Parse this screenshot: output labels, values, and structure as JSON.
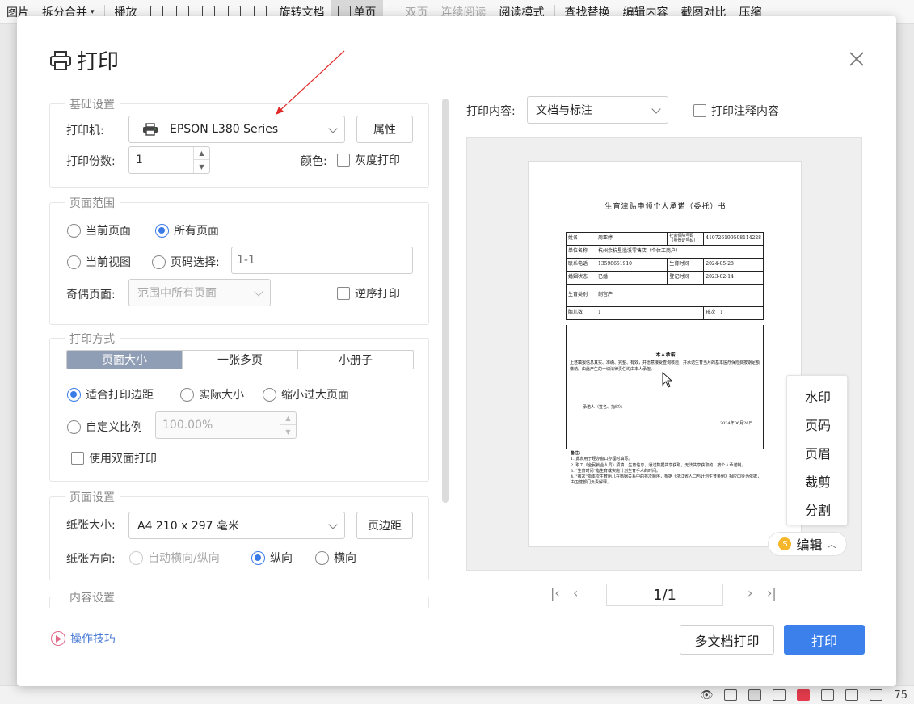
{
  "app_toolbar": {
    "items": [
      "图片",
      "拆分合并",
      "播放",
      "旋转文档",
      "单页",
      "双页",
      "连续阅读",
      "阅读模式",
      "查找替换",
      "编辑内容",
      "截图对比",
      "压缩"
    ]
  },
  "statusbar": {
    "zoom": "75"
  },
  "dialog": {
    "title": "打印",
    "basic": {
      "legend": "基础设置",
      "printer_label": "打印机:",
      "printer_value": "EPSON L380 Series",
      "properties_btn": "属性",
      "copies_label": "打印份数:",
      "copies_value": "1",
      "color_label": "颜色:",
      "grayscale_label": "灰度打印"
    },
    "range": {
      "legend": "页面范围",
      "current_page": "当前页面",
      "all_pages": "所有页面",
      "current_view": "当前视图",
      "page_select": "页码选择:",
      "page_select_placeholder": "1-1",
      "odd_even_label": "奇偶页面:",
      "odd_even_value": "范围中所有页面",
      "reverse_label": "逆序打印"
    },
    "mode": {
      "legend": "打印方式",
      "tabs": [
        "页面大小",
        "一张多页",
        "小册子"
      ],
      "fit_margin": "适合打印边距",
      "actual_size": "实际大小",
      "shrink_large": "缩小过大页面",
      "custom_scale": "自定义比例",
      "custom_scale_value": "100.00%",
      "duplex_label": "使用双面打印"
    },
    "page_setup": {
      "legend": "页面设置",
      "paper_size_label": "纸张大小:",
      "paper_size_value": "A4 210 x 297 毫米",
      "margin_btn": "页边距",
      "orientation_label": "纸张方向:",
      "auto": "自动横向/纵向",
      "portrait": "纵向",
      "landscape": "横向"
    },
    "content_setup": {
      "legend": "内容设置"
    },
    "preview": {
      "content_label": "打印内容:",
      "content_value": "文档与标注",
      "print_annotations": "打印注释内容",
      "side_menu": [
        "水印",
        "页码",
        "页眉",
        "裁剪",
        "分割"
      ],
      "edit_btn": "编辑",
      "page_indicator": "1/1"
    },
    "footer": {
      "tips": "操作技巧",
      "multi_doc_print": "多文档打印",
      "print": "打印"
    }
  },
  "document": {
    "title": "生育津贴申领个人承诺（委托）书",
    "rows": [
      [
        "姓名",
        "周亚婷",
        "社会保障号码（身份证号码）",
        "410726199508114228"
      ],
      [
        "单位名称",
        "杭州余杭星溢溪零售店（个体工商户）",
        "",
        ""
      ],
      [
        "联系电话",
        "13598651910",
        "生育时间",
        "2024-05-28"
      ],
      [
        "婚姻状态",
        "已婚",
        "登记时间",
        "2023-02-14"
      ],
      [
        "生育类别",
        "剖宫产",
        "",
        ""
      ],
      [
        "胎儿数",
        "1",
        "孩次",
        "1"
      ]
    ],
    "pledge_title": "本人承诺",
    "pledge_text": "上述填报信息真实、准确、完整、有效，并愿意接受查询核验，并承诺生育当月的基本医疗保险费按期足额缴纳。由此产生的一切法律责任均由本人承担。",
    "signer": "承诺人（签名、指印）：",
    "date": "2024年06月26日",
    "notes": [
      "备注：",
      "1. 此表用于经办窗口办理时填写。",
      "2. 职工《全民就业人员》须填，生育信息，通过数据共享获取，无法共享获取的，按个人承诺制。",
      "3. \"生育时间\"指生育或实施计划生育手术的时间。",
      "4. \"孩次\"指本次生育胎儿在婚姻关系中的孩次顺序，根据《浙江省人口与计划生育条例》相应口径为依据，由卫健部门负责解释。"
    ]
  }
}
